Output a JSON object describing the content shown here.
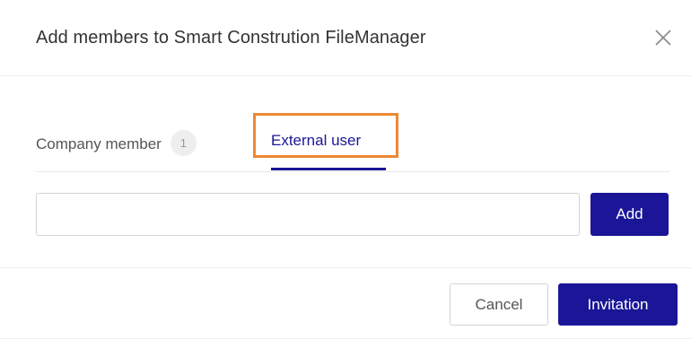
{
  "dialog": {
    "title": "Add members to Smart Constrution FileManager",
    "close_icon": "close-icon"
  },
  "tabs": [
    {
      "label": "Company member",
      "count": "1",
      "active": false
    },
    {
      "label": "External user",
      "active": true
    }
  ],
  "invite": {
    "input_value": "",
    "input_placeholder": "",
    "add_label": "Add"
  },
  "footer": {
    "cancel_label": "Cancel",
    "invitation_label": "Invitation"
  },
  "colors": {
    "accent": "#1a1697",
    "highlight": "#ee8833",
    "badge_bg": "#eeeeee"
  }
}
